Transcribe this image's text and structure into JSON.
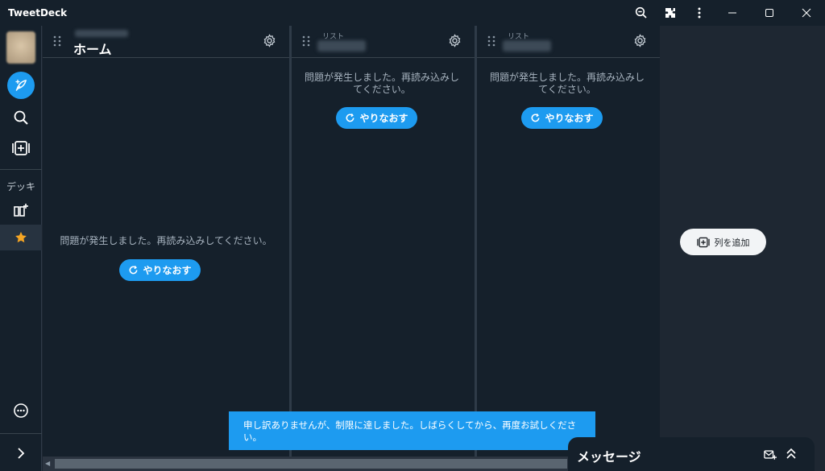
{
  "window": {
    "title": "TweetDeck"
  },
  "nav": {
    "deck_label": "デッキ"
  },
  "columns": [
    {
      "title": "ホーム",
      "subtitle": "",
      "error": "問題が発生しました。再読み込みしてください。",
      "retry": "やりなおす"
    },
    {
      "title": "",
      "subtitle": "リスト",
      "error": "問題が発生しました。再読み込みしてください。",
      "retry": "やりなおす"
    },
    {
      "title": "",
      "subtitle": "リスト",
      "error": "問題が発生しました。再読み込みしてください。",
      "retry": "やりなおす"
    }
  ],
  "add_column": {
    "label": "列を追加"
  },
  "toast": {
    "message": "申し訳ありませんが、制限に達しました。しばらくしてから、再度お試しください。"
  },
  "messages": {
    "title": "メッセージ"
  },
  "colors": {
    "accent": "#1d9bf0",
    "background": "#15202b",
    "star": "#f4a524"
  }
}
